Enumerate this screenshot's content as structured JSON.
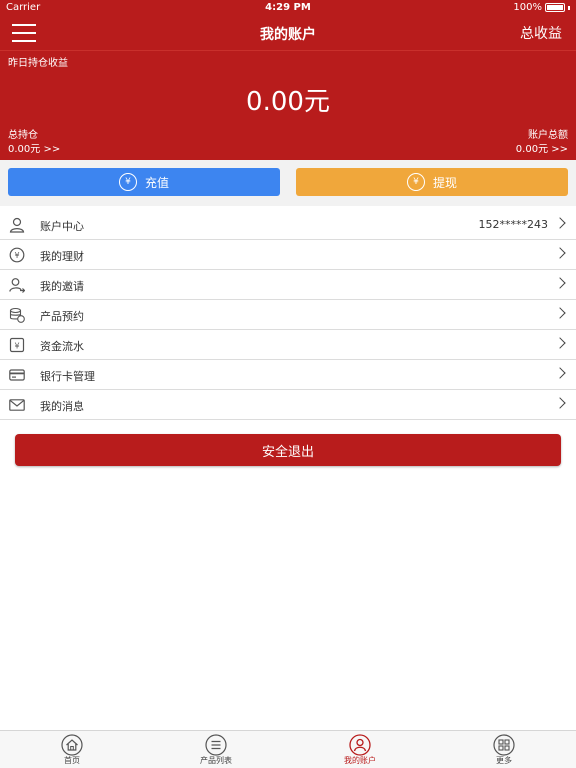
{
  "status_bar": {
    "carrier": "Carrier",
    "time": "4:29 PM",
    "battery": "100%"
  },
  "navbar": {
    "title": "我的账户",
    "right_link": "总收益"
  },
  "hero": {
    "yesterday_label": "昨日持仓收益",
    "amount": "0.00元",
    "holdings_label": "总持仓",
    "holdings_value": "0.00元 >>",
    "total_label": "账户总额",
    "total_value": "0.00元 >>"
  },
  "actions": {
    "recharge": "充值",
    "withdraw": "提现"
  },
  "menu": [
    {
      "label": "账户中心",
      "value": "152*****243",
      "icon": "user-icon"
    },
    {
      "label": "我的理财",
      "value": "",
      "icon": "yen-circle-icon"
    },
    {
      "label": "我的邀请",
      "value": "",
      "icon": "invite-icon"
    },
    {
      "label": "产品预约",
      "value": "",
      "icon": "coins-icon"
    },
    {
      "label": "资金流水",
      "value": "",
      "icon": "yen-square-icon"
    },
    {
      "label": "银行卡管理",
      "value": "",
      "icon": "card-icon"
    },
    {
      "label": "我的消息",
      "value": "",
      "icon": "mail-icon"
    }
  ],
  "logout": "安全退出",
  "tabs": [
    {
      "label": "首页",
      "icon": "home-icon"
    },
    {
      "label": "产品列表",
      "icon": "list-icon"
    },
    {
      "label": "我的账户",
      "icon": "account-icon"
    },
    {
      "label": "更多",
      "icon": "grid-icon"
    }
  ],
  "colors": {
    "brand_red": "#b81c1c",
    "blue": "#3d85f0",
    "orange": "#f0a73b"
  }
}
